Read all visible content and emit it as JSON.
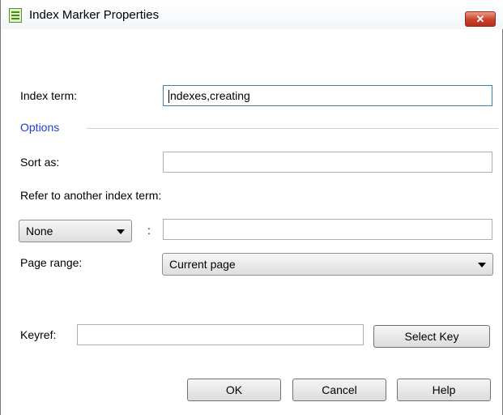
{
  "window": {
    "title": "Index Marker Properties",
    "close_label": "✕"
  },
  "index_term": {
    "label": "Index term:",
    "value": "ndexes,creating"
  },
  "options": {
    "label": "Options"
  },
  "sort_as": {
    "label": "Sort as:",
    "value": ""
  },
  "refer": {
    "label": "Refer to another index term:",
    "selected": "None",
    "separator": ":",
    "value": ""
  },
  "page_range": {
    "label": "Page range:",
    "selected": "Current page"
  },
  "keyref": {
    "label": "Keyref:",
    "value": "",
    "select_key_label": "Select Key"
  },
  "footer": {
    "ok_label": "OK",
    "cancel_label": "Cancel",
    "help_label": "Help"
  }
}
